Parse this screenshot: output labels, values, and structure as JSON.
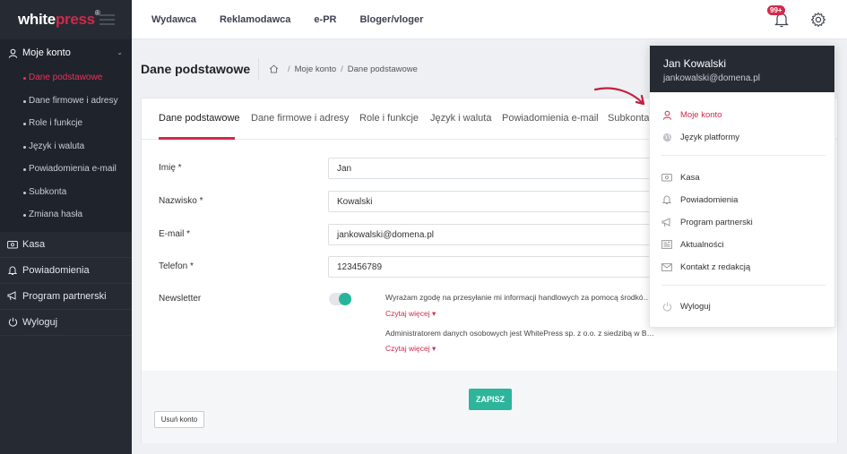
{
  "brand": {
    "logo_white": "white",
    "logo_accent": "press",
    "logo_mark": "®"
  },
  "sidebar": {
    "section_title": "Moje konto",
    "sub_items": [
      {
        "label": "Dane podstawowe",
        "active": true
      },
      {
        "label": "Dane firmowe i adresy"
      },
      {
        "label": "Role i funkcje"
      },
      {
        "label": "Język i waluta"
      },
      {
        "label": "Powiadomienia e-mail"
      },
      {
        "label": "Subkonta"
      },
      {
        "label": "Zmiana hasła"
      }
    ],
    "items": [
      {
        "label": "Kasa"
      },
      {
        "label": "Powiadomienia"
      },
      {
        "label": "Program partnerski"
      },
      {
        "label": "Wyloguj"
      }
    ]
  },
  "topnav": {
    "items": [
      "Wydawca",
      "Reklamodawca",
      "e-PR",
      "Bloger/vloger"
    ],
    "badge": "99+"
  },
  "page": {
    "title": "Dane podstawowe",
    "breadcrumb": [
      "Moje konto",
      "Dane podstawowe"
    ]
  },
  "tabs": [
    "Dane podstawowe",
    "Dane firmowe i adresy",
    "Role i funkcje",
    "Język i waluta",
    "Powiadomienia e-mail",
    "Subkonta"
  ],
  "form": {
    "first_name": {
      "label": "Imię *",
      "value": "Jan"
    },
    "last_name": {
      "label": "Nazwisko *",
      "value": "Kowalski"
    },
    "email": {
      "label": "E-mail *",
      "value": "jankowalski@domena.pl"
    },
    "phone": {
      "label": "Telefon *",
      "value": "123456789"
    },
    "newsletter": {
      "label": "Newsletter",
      "on": true,
      "consent_1": "Wyrażam zgodę na przesyłanie mi informacji handlowych za pomocą środków komunikacji elektronicznej",
      "consent_2": "Administratorem danych osobowych jest WhitePress sp. z o.o. z siedzibą w Bielsku-Białej",
      "read_more": "Czytaj więcej"
    },
    "save_label": "ZAPISZ",
    "delete_label": "Usuń konto"
  },
  "dropdown": {
    "name": "Jan Kowalski",
    "email": "jankowalski@domena.pl",
    "items": [
      {
        "label": "Moje konto",
        "active": true
      },
      {
        "label": "Język platformy"
      },
      {
        "label": "Kasa"
      },
      {
        "label": "Powiadomienia"
      },
      {
        "label": "Program partnerski"
      },
      {
        "label": "Aktualności"
      },
      {
        "label": "Kontakt z redakcją"
      },
      {
        "label": "Wyloguj"
      }
    ]
  },
  "colors": {
    "accent": "#d1294b",
    "sidebar": "#262a33",
    "save": "#2db59b"
  }
}
